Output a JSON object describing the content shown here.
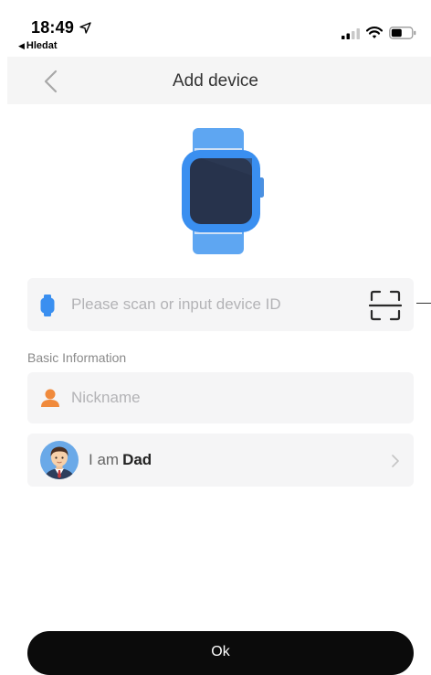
{
  "status_bar": {
    "time": "18:49",
    "back_app": "Hledat"
  },
  "nav": {
    "title": "Add device"
  },
  "device": {
    "placeholder": "Please scan or input device ID",
    "value": ""
  },
  "basic_info": {
    "section_label": "Basic Information",
    "nickname_placeholder": "Nickname",
    "nickname_value": "",
    "relation_prefix": "I am",
    "relation_value": "Dad"
  },
  "actions": {
    "ok_label": "Ok"
  },
  "colors": {
    "accent_blue": "#3a8ff0",
    "person_orange": "#f08a3c",
    "button_black": "#0b0b0b",
    "row_background": "#f5f5f6"
  },
  "icons": {
    "location": "location-arrow-icon",
    "signal": "cellular-signal-icon",
    "wifi": "wifi-icon",
    "battery": "battery-icon",
    "back": "back-chevron-icon",
    "watch": "smartwatch-icon",
    "scan": "scan-qr-icon",
    "person": "person-icon",
    "avatar": "dad-avatar-icon",
    "chevron": "chevron-right-icon"
  }
}
